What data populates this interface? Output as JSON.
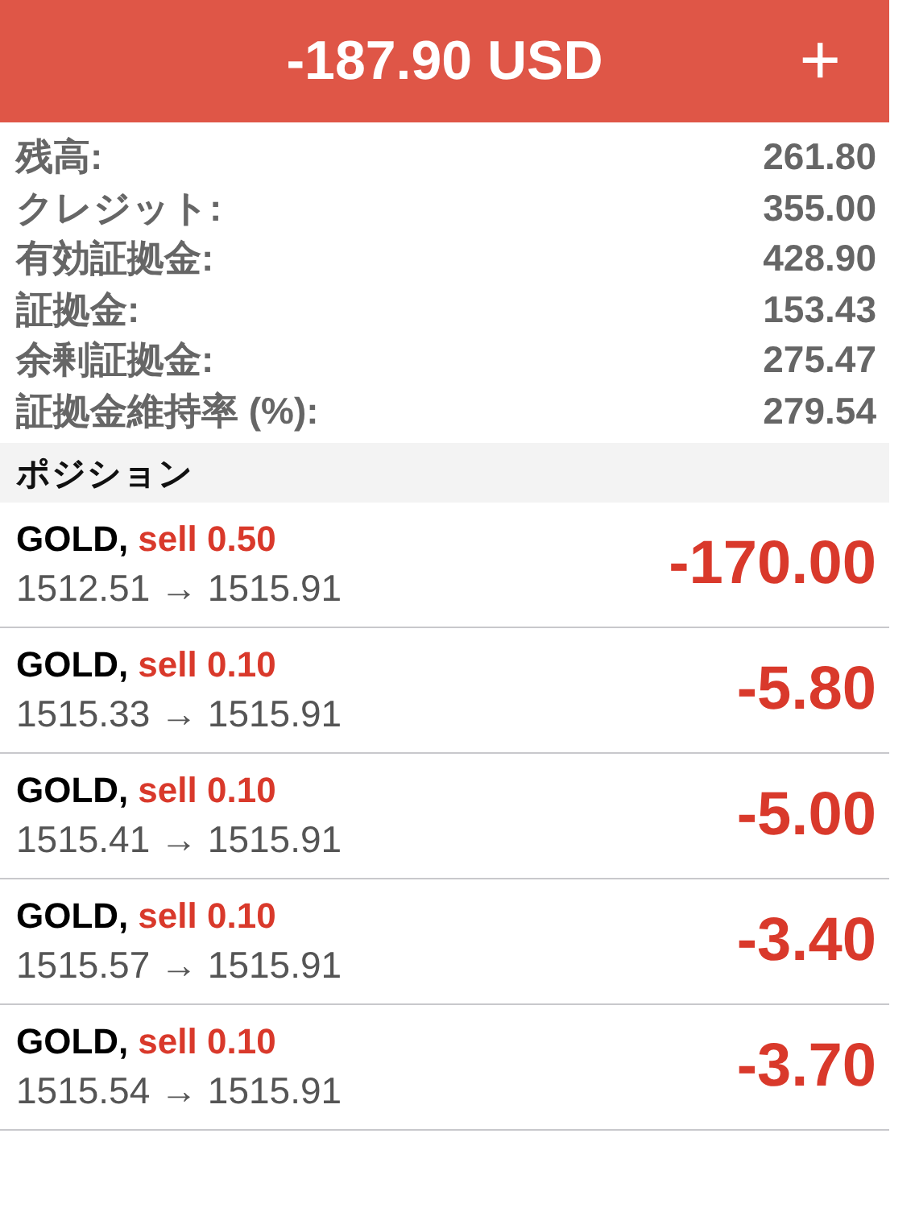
{
  "header": {
    "title": "-187.90 USD",
    "add_button": "+"
  },
  "summary": [
    {
      "label": "残高:",
      "value": "261.80"
    },
    {
      "label": "クレジット:",
      "value": "355.00"
    },
    {
      "label": "有効証拠金:",
      "value": "428.90"
    },
    {
      "label": "証拠金:",
      "value": "153.43"
    },
    {
      "label": "余剰証拠金:",
      "value": "275.47"
    },
    {
      "label": "証拠金維持率 (%):",
      "value": "279.54"
    }
  ],
  "positions_section": {
    "title": "ポジション"
  },
  "positions": [
    {
      "symbol": "GOLD,",
      "order": "sell 0.50",
      "prices": "1512.51 → 1515.91",
      "profit": "-170.00"
    },
    {
      "symbol": "GOLD,",
      "order": "sell 0.10",
      "prices": "1515.33 → 1515.91",
      "profit": "-5.80"
    },
    {
      "symbol": "GOLD,",
      "order": "sell 0.10",
      "prices": "1515.41 → 1515.91",
      "profit": "-5.00"
    },
    {
      "symbol": "GOLD,",
      "order": "sell 0.10",
      "prices": "1515.57 → 1515.91",
      "profit": "-3.40"
    },
    {
      "symbol": "GOLD,",
      "order": "sell 0.10",
      "prices": "1515.54 → 1515.91",
      "profit": "-3.70"
    }
  ]
}
